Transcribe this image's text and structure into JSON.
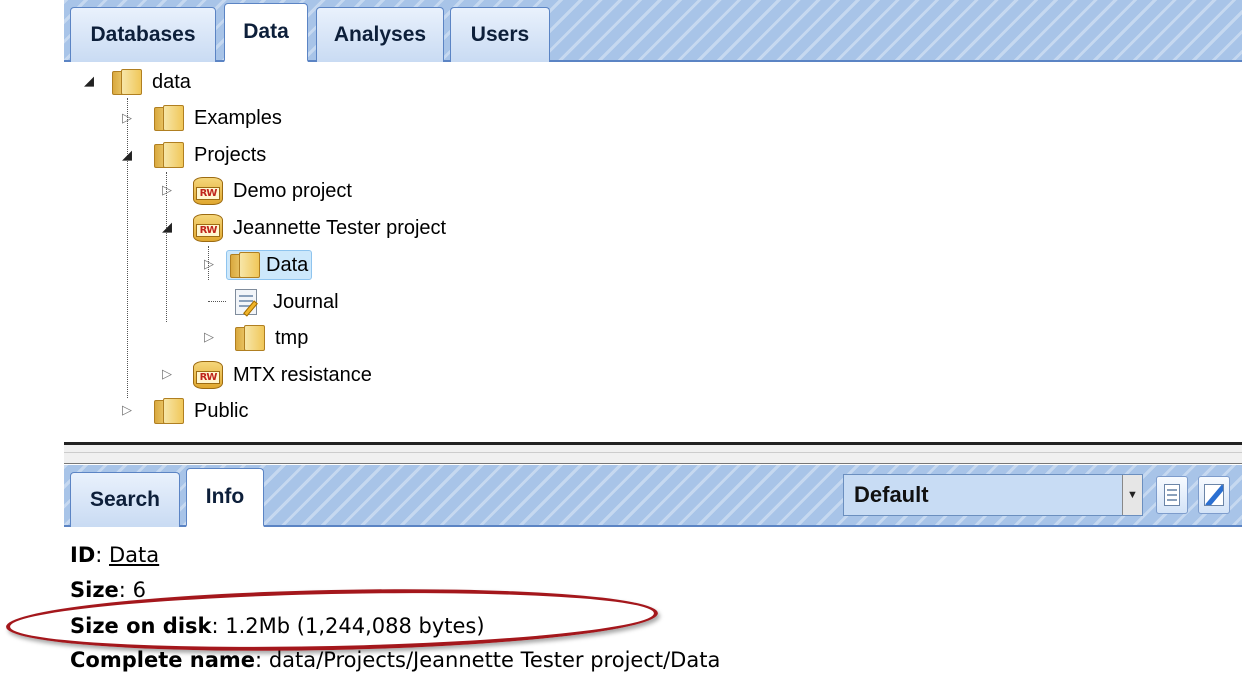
{
  "top_tabs": [
    {
      "label": "Databases",
      "active": false
    },
    {
      "label": "Data",
      "active": true
    },
    {
      "label": "Analyses",
      "active": false
    },
    {
      "label": "Users",
      "active": false
    }
  ],
  "tree": {
    "root": "data",
    "examples": "Examples",
    "projects": "Projects",
    "demo_project": "Demo project",
    "jt_project": "Jeannette Tester project",
    "jt_data": "Data",
    "jt_journal": "Journal",
    "jt_tmp": "tmp",
    "mtx": "MTX resistance",
    "public": "Public",
    "project_badge": "RW"
  },
  "bottom_tabs": [
    {
      "label": "Search",
      "active": false
    },
    {
      "label": "Info",
      "active": true
    }
  ],
  "view_select": {
    "value": "Default"
  },
  "info": {
    "id_key": "ID",
    "id_value": "Data",
    "size_key": "Size",
    "size_value": "6",
    "disk_key": "Size on disk",
    "disk_value": "1.2Mb (1,244,088 bytes)",
    "name_key": "Complete name",
    "name_value": "data/Projects/Jeannette Tester project/Data"
  },
  "highlight_color": "#a4171c",
  "accent_color": "#a8c4e8"
}
